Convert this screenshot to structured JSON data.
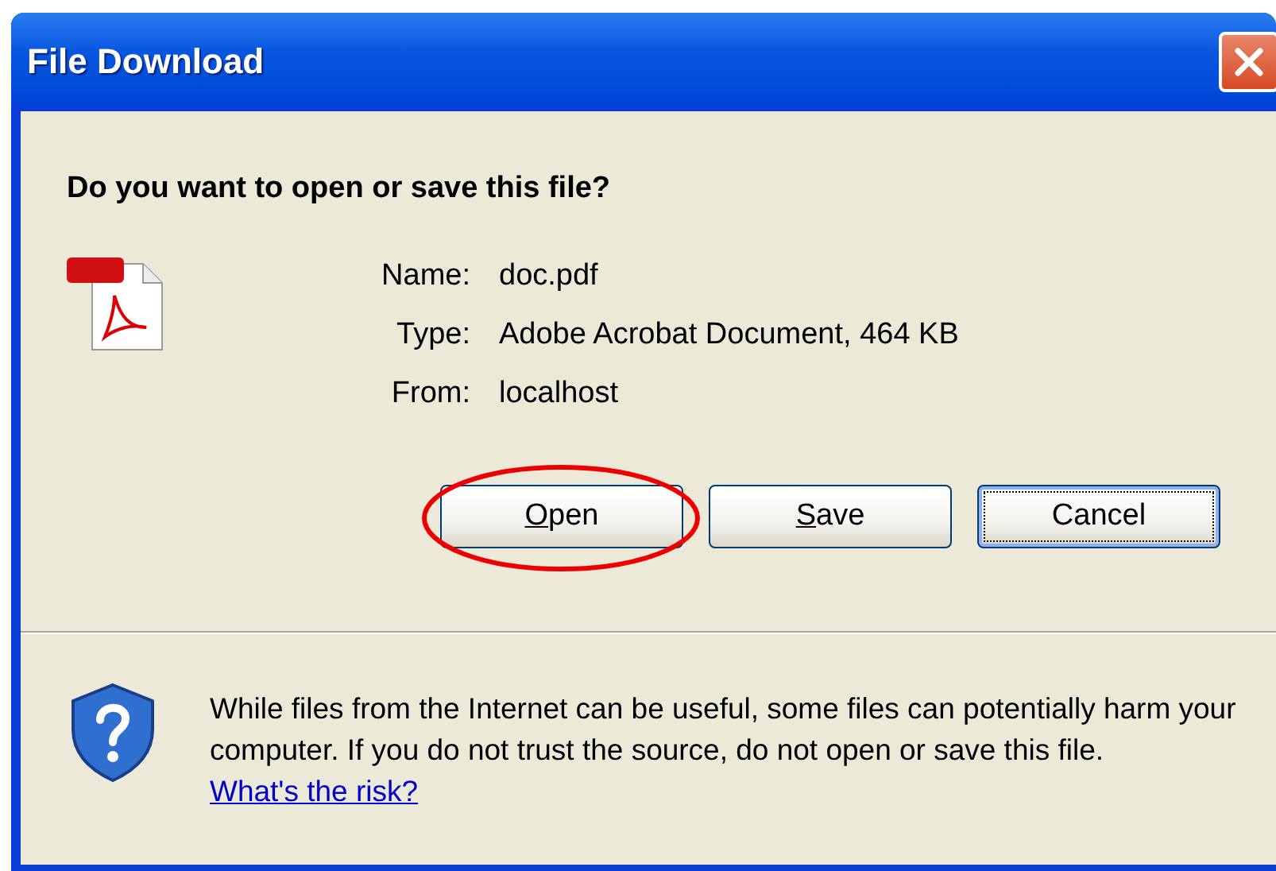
{
  "window": {
    "title": "File Download"
  },
  "question": "Do you want to open or save this file?",
  "file_info": [
    {
      "label": "Name:",
      "value": "doc.pdf"
    },
    {
      "label": "Type:",
      "value": "Adobe Acrobat Document, 464 KB"
    },
    {
      "label": "From:",
      "value": "localhost"
    }
  ],
  "buttons": [
    {
      "label": "Open",
      "underline_first": true,
      "focused": false,
      "circled": true
    },
    {
      "label": "Save",
      "underline_first": true,
      "focused": false,
      "circled": false
    },
    {
      "label": "Cancel",
      "underline_first": false,
      "focused": true,
      "circled": false
    }
  ],
  "warning": {
    "text": "While files from the Internet can be useful, some files can potentially harm your computer. If you do not trust the source, do not open or save this file.",
    "link": "What's the risk?"
  }
}
